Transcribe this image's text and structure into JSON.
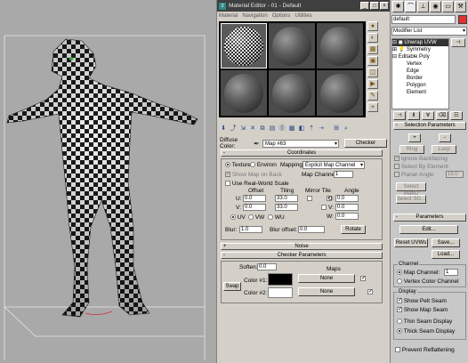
{
  "material_editor": {
    "title": "Material Editor - 01 - Default",
    "window_buttons": [
      "_",
      "□",
      "×"
    ],
    "menu": [
      "Material",
      "Navigation",
      "Options",
      "Utilities"
    ],
    "slot_count": 6,
    "diffuse_label": "Diffuse Color:",
    "map_name": "Map #63",
    "map_type_button": "Checker",
    "coordinates": {
      "header": "Coordinates",
      "texture_label": "Texture",
      "environ_label": "Environ",
      "mapping_label": "Mapping:",
      "mapping_value": "Explicit Map Channel",
      "show_map_on_back": "Show Map on Back",
      "map_channel_label": "Map Channel:",
      "map_channel_value": "1",
      "use_real_world_scale": "Use Real-World Scale",
      "col_offset": "Offset",
      "col_tiling": "Tiling",
      "col_mirror_tile": "Mirror Tile",
      "col_angle": "Angle",
      "u_label": "U:",
      "v_label": "V:",
      "w_label": "W:",
      "u_offset": "0.0",
      "u_tiling": "33.0",
      "u_angle": "0.0",
      "v_offset": "0.0",
      "v_tiling": "33.0",
      "v_angle": "0.0",
      "w_angle": "0.0",
      "uv_label": "UV",
      "vw_label": "VW",
      "wu_label": "WU",
      "blur_label": "Blur:",
      "blur_value": "1.0",
      "blur_offset_label": "Blur offset:",
      "blur_offset_value": "0.0",
      "rotate_button": "Rotate"
    },
    "noise_header": "Noise",
    "checker_params": {
      "header": "Checker Parameters",
      "soften_label": "Soften:",
      "soften_value": "0.0",
      "maps_label": "Maps",
      "swap_button": "Swap",
      "color1_label": "Color #1:",
      "color2_label": "Color #2:",
      "color1": "#000000",
      "color2": "#ffffff",
      "map1_button": "None",
      "map2_button": "None"
    }
  },
  "command_panel": {
    "object_name": "default",
    "modifier_list_label": "Modifier List",
    "stack": [
      "Unwrap UVW",
      "Symmetry",
      "Editable Poly",
      "Vertex",
      "Edge",
      "Border",
      "Polygon",
      "Element"
    ],
    "selection_params": {
      "header": "Selection Parameters",
      "ring_button": "Ring",
      "loop_button": "Loop",
      "ignore_backfacing": "Ignore Backfacing",
      "select_by_element": "Select By Element",
      "planar_angle": "Planar Angle",
      "planar_angle_value": "15.0",
      "select_matid_button": "Select MatID",
      "select_sg_button": "Select SG..."
    },
    "parameters": {
      "header": "Parameters",
      "edit_button": "Edit...",
      "reset_uvws_button": "Reset UVWs",
      "save_button": "Save...",
      "load_button": "Load...",
      "channel_group": "Channel",
      "map_channel_label": "Map Channel:",
      "map_channel_value": "1",
      "vertex_color_channel": "Vertex Color Channel",
      "display_group": "Display",
      "show_pelt_seam": "Show Pelt Seam",
      "show_map_seam": "Show Map Seam",
      "thin_seam_display": "Thin Seam Display",
      "thick_seam_display": "Thick Seam Display",
      "prevent_reflattening": "Prevent Reflattening"
    }
  }
}
